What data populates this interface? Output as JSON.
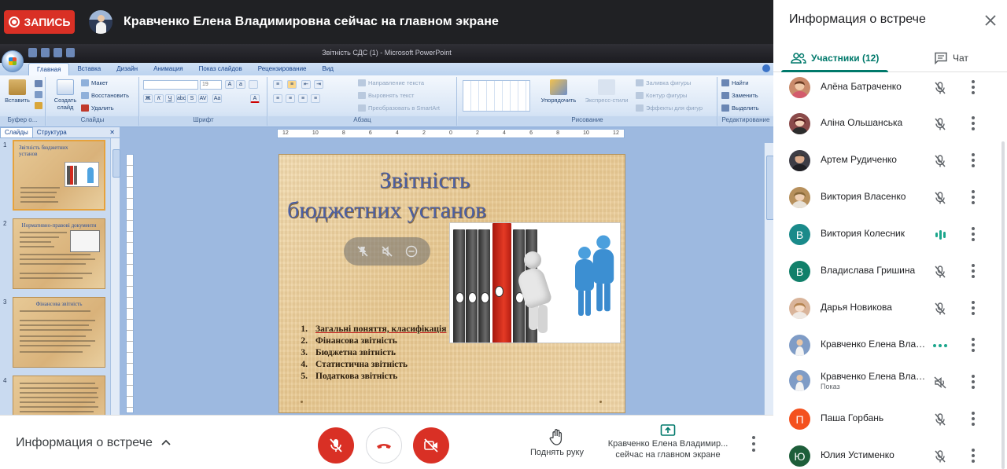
{
  "topbar": {
    "record_label": "ЗАПИСЬ",
    "presenter_text": "Кравченко Елена Владимировна сейчас на главном экране"
  },
  "powerpoint": {
    "window_title": "Звітність СДС (1)  -  Microsoft PowerPoint",
    "tabs": [
      "Главная",
      "Вставка",
      "Дизайн",
      "Анимация",
      "Показ слайдов",
      "Рецензирование",
      "Вид"
    ],
    "active_tab": "Главная",
    "ribbon": {
      "paste": "Вставить",
      "new_slide": "Создать слайд",
      "layout": "Макет",
      "reset": "Восстановить",
      "delete": "Удалить",
      "font_size": "19",
      "text_direction": "Направление текста",
      "align_text": "Выровнять текст",
      "smartart": "Преобразовать в SmartArt",
      "arrange": "Упорядочить",
      "quick_styles": "Экспресс-стили",
      "shape_fill": "Заливка фигуры",
      "shape_outline": "Контур фигуры",
      "shape_effects": "Эффекты для фигур",
      "find": "Найти",
      "replace": "Заменить",
      "select": "Выделить",
      "groups": [
        "Буфер о...",
        "Слайды",
        "Шрифт",
        "Абзац",
        "Рисование",
        "Редактирование"
      ]
    },
    "side_tabs": [
      "Слайды",
      "Структура"
    ],
    "thumbnails": [
      {
        "num": "1",
        "title": "Звітність бюджетних установ"
      },
      {
        "num": "2",
        "title": "Нормативно-правові документи"
      },
      {
        "num": "3",
        "title": "Фінансова звітність"
      },
      {
        "num": "4",
        "title": ""
      }
    ],
    "ruler_marks": [
      "12",
      "10",
      "8",
      "6",
      "4",
      "2",
      "0",
      "2",
      "4",
      "6",
      "8",
      "10",
      "12"
    ],
    "slide": {
      "title_line1": "Звітність",
      "title_line2": "бюджетних установ",
      "items": [
        {
          "n": "1.",
          "text": "Загальні поняття, класифікація"
        },
        {
          "n": "2.",
          "text": "Фінансова звітність"
        },
        {
          "n": "3.",
          "text": "Бюджетна звітність"
        },
        {
          "n": "4.",
          "text": "Статистична звітність"
        },
        {
          "n": "5.",
          "text": "Податкова звітність"
        }
      ]
    }
  },
  "bottombar": {
    "meeting_details": "Информация о встрече",
    "raise_hand": "Поднять руку",
    "presenting_line1": "Кравченко Елена Владимир...",
    "presenting_line2": "сейчас на главном экране"
  },
  "panel": {
    "title": "Информация о встрече",
    "people_tab": "Участники (12)",
    "chat_tab": "Чат",
    "participants": [
      {
        "name": "Алёна Батраченко",
        "status": "muted",
        "avatar_color": "#c98a6a"
      },
      {
        "name": "Аліна Ольшанська",
        "status": "muted",
        "avatar_color": "#8a4a4a"
      },
      {
        "name": "Артем Рудиченко",
        "status": "muted",
        "avatar_color": "#3d3d46"
      },
      {
        "name": "Виктория Власенко",
        "status": "muted",
        "avatar_color": "#b7905c"
      },
      {
        "name": "Виктория Колесник",
        "initial": "В",
        "status": "speaking",
        "avatar_color": "#1a8a8a"
      },
      {
        "name": "Владислава Гришина",
        "initial": "В",
        "status": "muted",
        "avatar_color": "#11806a"
      },
      {
        "name": "Дарья Новикова",
        "status": "muted",
        "avatar_color": "#d9b49a"
      },
      {
        "name": "Кравченко Елена Влад...",
        "status": "active",
        "avatar_color": "#7f9cc6"
      },
      {
        "name": "Кравченко Елена Влад...",
        "sub": "Показ",
        "status": "audio-off",
        "avatar_color": "#7f9cc6"
      },
      {
        "name": "Паша Горбань",
        "initial": "П",
        "status": "muted",
        "avatar_color": "#f4511e"
      },
      {
        "name": "Юлия Устименко",
        "initial": "Ю",
        "status": "muted",
        "avatar_color": "#1e5e3a"
      }
    ]
  },
  "colors": {
    "record_red": "#d93025",
    "meet_teal": "#00796b",
    "speaking_teal": "#1ca68c"
  }
}
